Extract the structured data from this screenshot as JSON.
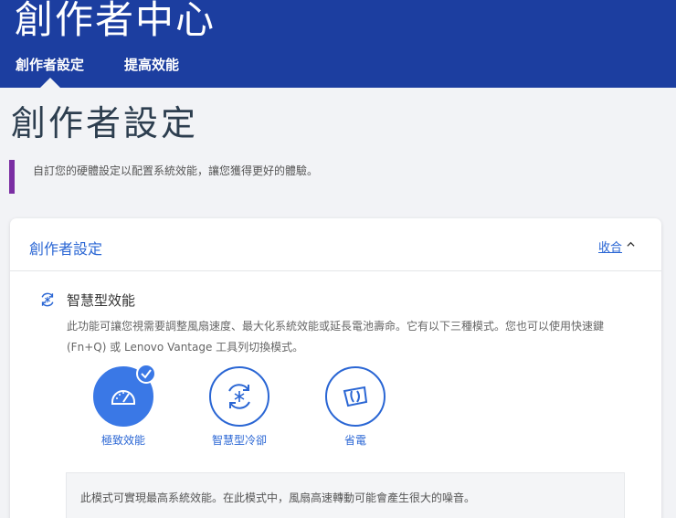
{
  "header": {
    "app_title": "創作者中心",
    "tabs": [
      {
        "label": "創作者設定",
        "active": true
      },
      {
        "label": "提高效能",
        "active": false
      }
    ]
  },
  "page": {
    "title": "創作者設定",
    "description": "自訂您的硬體設定以配置系統效能，讓您獲得更好的體驗。"
  },
  "card": {
    "title": "創作者設定",
    "collapse_label": "收合",
    "section": {
      "title": "智慧型效能",
      "description": "此功能可讓您視需要調整風扇速度、最大化系統效能或延長電池壽命。它有以下三種模式。您也可以使用快速鍵 (Fn+Q) 或 Lenovo Vantage 工具列切換模式。",
      "modes": [
        {
          "label": "極致效能",
          "icon": "speedometer-icon",
          "selected": true
        },
        {
          "label": "智慧型冷卻",
          "icon": "snowflake-cycle-icon",
          "selected": false
        },
        {
          "label": "省電",
          "icon": "leaf-icon",
          "selected": false
        }
      ],
      "mode_info": "此模式可實現最高系統效能。在此模式中，風扇高速轉動可能會產生很大的噪音。"
    }
  },
  "colors": {
    "banner": "#1c3ea0",
    "accent": "#2a66d4",
    "active_mode": "#3a78e6",
    "description_bar": "#7b2ea3"
  }
}
